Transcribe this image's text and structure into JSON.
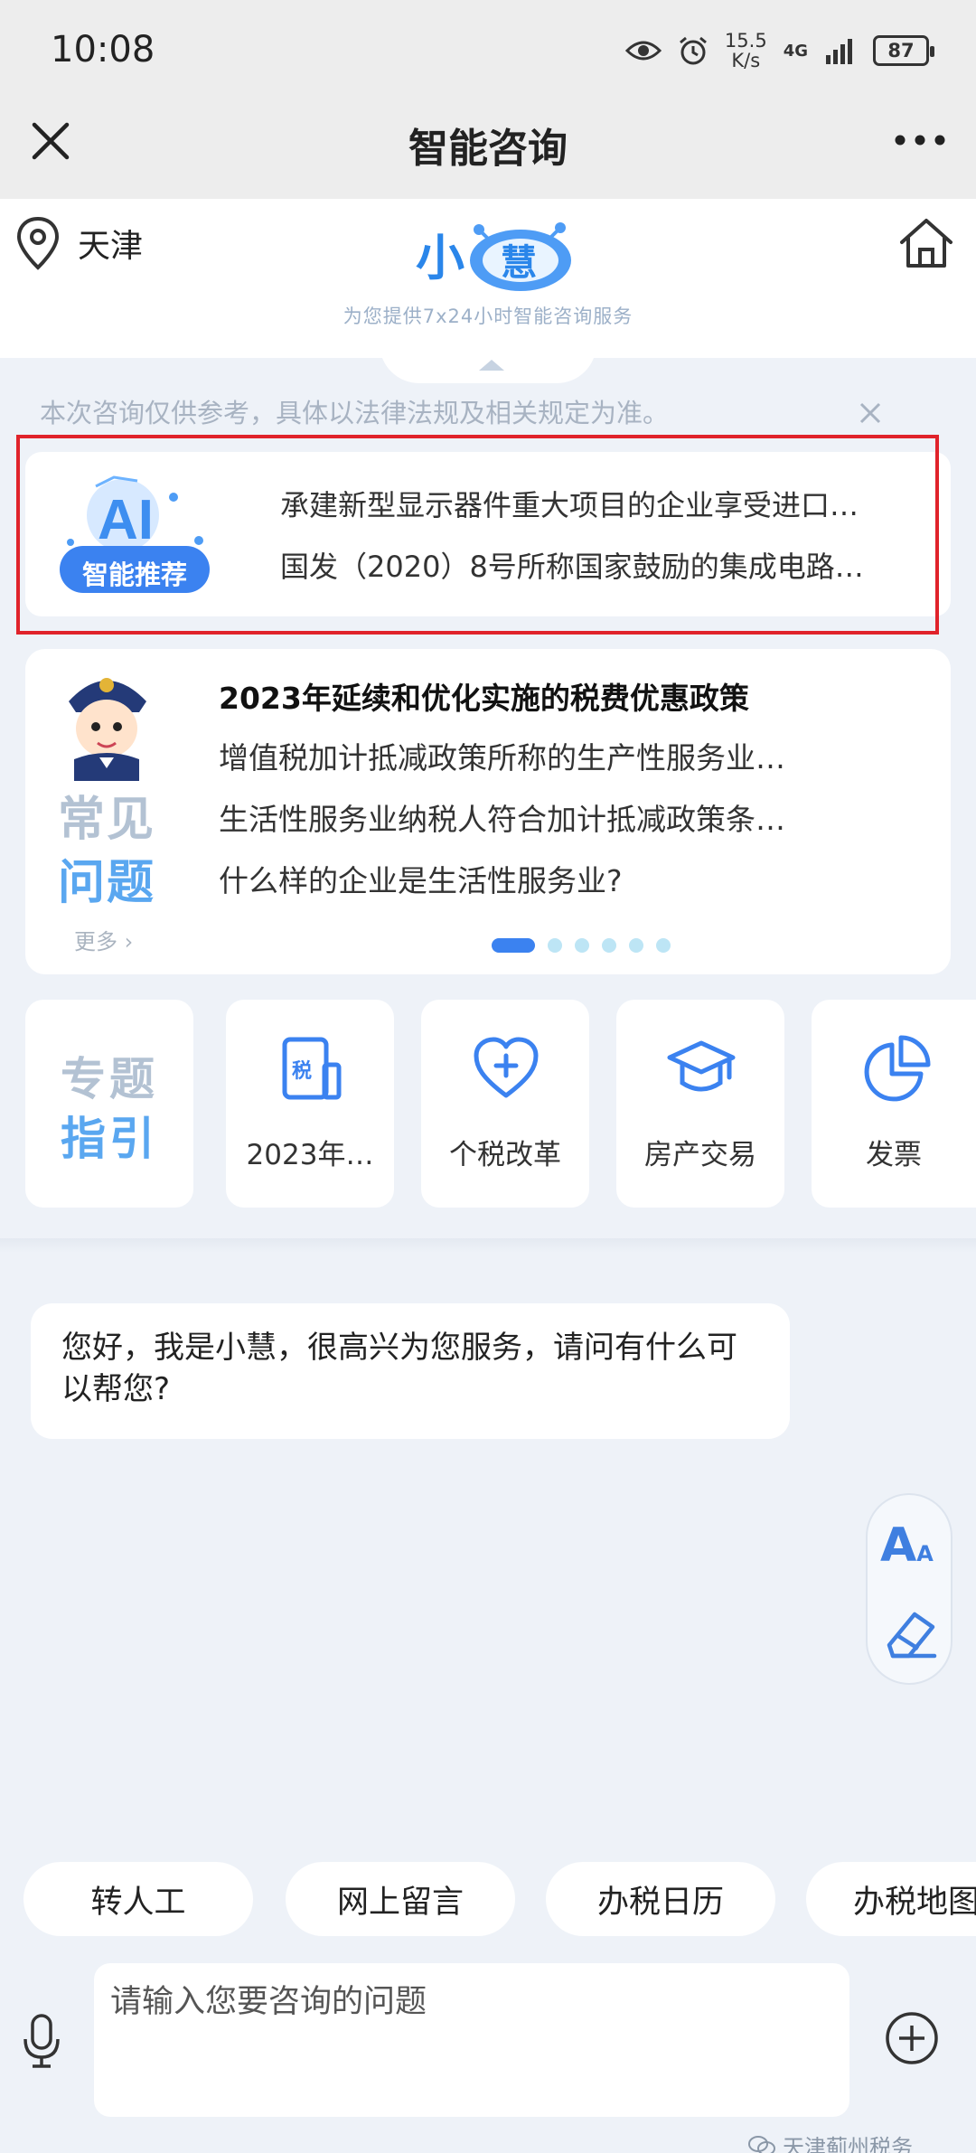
{
  "status_bar": {
    "time": "10:08",
    "speed_value": "15.5",
    "speed_unit": "K/s",
    "network": "4G",
    "battery": "87"
  },
  "nav": {
    "title": "智能咨询"
  },
  "header": {
    "location": "天津",
    "logo_char_1": "小",
    "logo_char_2": "慧",
    "logo_subtitle": "为您提供7x24小时智能咨询服务"
  },
  "disclaimer": "本次咨询仅供参考，具体以法律法规及相关规定为准。",
  "recommend": {
    "badge": "智能推荐",
    "badge_letters": "AI",
    "items": [
      "承建新型显示器件重大项目的企业享受进口…",
      "国发（2020）8号所称国家鼓励的集成电路…"
    ]
  },
  "faq": {
    "title_line1": "常见",
    "title_line2": "问题",
    "more": "更多",
    "heading": "2023年延续和优化实施的税费优惠政策",
    "questions": [
      "增值税加计抵减政策所称的生产性服务业…",
      "生活性服务业纳税人符合加计抵减政策条…",
      "什么样的企业是生活性服务业?"
    ],
    "page_count": 6,
    "active_page": 1
  },
  "topics": {
    "title_line1": "专题",
    "title_line2": "指引",
    "items": [
      {
        "label": "2023年…",
        "icon": "tax-document-icon",
        "glyph": "税"
      },
      {
        "label": "个税改革",
        "icon": "heart-plus-icon"
      },
      {
        "label": "房产交易",
        "icon": "graduation-cap-icon"
      },
      {
        "label": "发票",
        "icon": "pie-chart-icon"
      }
    ]
  },
  "chat": {
    "greeting": "您好，我是小慧，很高兴为您服务，请问有什么可以帮您?"
  },
  "tools": {
    "font_big": "A",
    "font_small": "A"
  },
  "quick_actions": [
    "转人工",
    "网上留言",
    "办税日历",
    "办税地图"
  ],
  "input": {
    "placeholder": "请输入您要咨询的问题"
  },
  "watermark": "天津蓟州税务",
  "colors": {
    "accent": "#3b82f0",
    "highlight_box": "#e0232b",
    "faq_title_blue": "#5aa7f0"
  }
}
